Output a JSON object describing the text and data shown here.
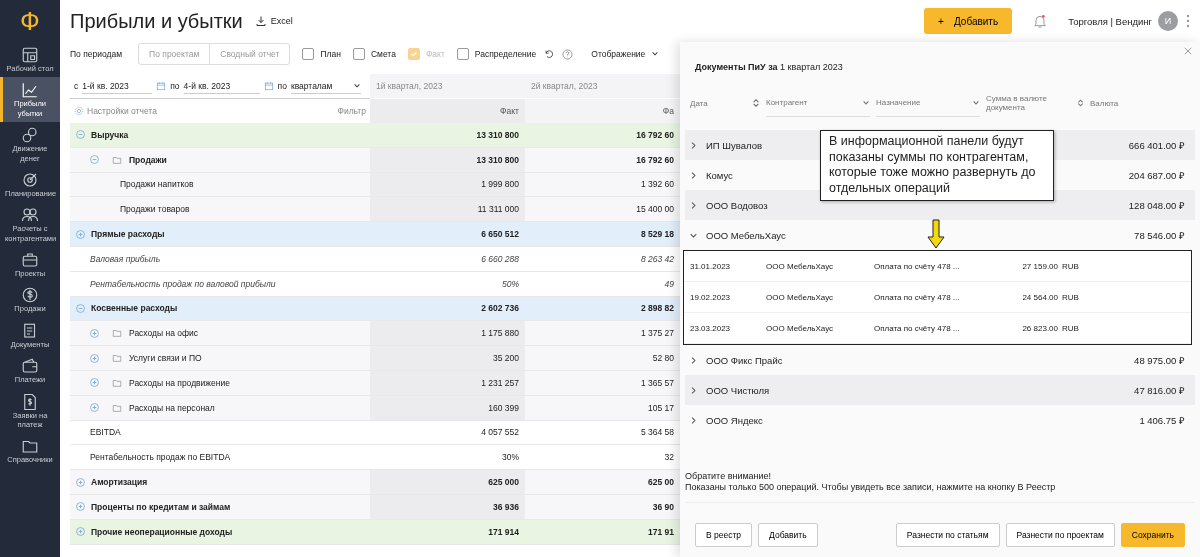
{
  "logo": "Ф",
  "sidebar": {
    "items": [
      {
        "label": "Рабочий стол",
        "selected": false
      },
      {
        "label": "Прибыли убытки",
        "selected": true
      },
      {
        "label": "Движение денег",
        "selected": false
      },
      {
        "label": "Планирование",
        "selected": false
      },
      {
        "label": "Расчеты с контрагентами",
        "selected": false
      },
      {
        "label": "Проекты",
        "selected": false
      },
      {
        "label": "Продажи",
        "selected": false
      },
      {
        "label": "Документы",
        "selected": false
      },
      {
        "label": "Платежи",
        "selected": false
      },
      {
        "label": "Заявки на платеж",
        "selected": false
      },
      {
        "label": "Справочники",
        "selected": false
      }
    ]
  },
  "page_title": "Прибыли и убытки",
  "export_label": "Excel",
  "add_button": "Добавить",
  "add_icon": "+",
  "account": {
    "name": "Торговля | Вендинг",
    "avatar": "И"
  },
  "view_tabs": [
    {
      "label": "По периодам",
      "selected": true
    },
    {
      "label": "По проектам",
      "selected": false
    },
    {
      "label": "Сводный отчет",
      "selected": false
    }
  ],
  "checkboxes": [
    {
      "label": "План",
      "checked": false,
      "disabled": false
    },
    {
      "label": "Смета",
      "checked": false,
      "disabled": false
    },
    {
      "label": "Факт",
      "checked": true,
      "disabled": true
    },
    {
      "label": "Распределение",
      "checked": false,
      "disabled": false
    }
  ],
  "display_menu": "Отображение",
  "period": {
    "from_label": "с",
    "from": "1-й кв. 2023",
    "to_label": "по",
    "to": "4-й кв. 2023",
    "by_label": "по",
    "by": "кварталам"
  },
  "settings_label": "Настройки отчета",
  "filter_label": "Фильтр",
  "table": {
    "columns": [
      {
        "period": "1й квартал, 2023",
        "measure": "Факт"
      },
      {
        "period": "2й квартал, 2023",
        "measure": "Фа"
      }
    ],
    "rows": [
      {
        "kind": "group",
        "label": "Выручка",
        "expanded": true,
        "color": "#e9f5e2",
        "values": [
          "13 310 800",
          "16 792 60"
        ]
      },
      {
        "kind": "folder",
        "label": "Продажи",
        "expanded": true,
        "values": [
          "13 310 800",
          "16 792 60"
        ]
      },
      {
        "kind": "leaf",
        "label": "Продажи напитков",
        "values": [
          "1 999 800",
          "1 392 60"
        ]
      },
      {
        "kind": "leaf",
        "label": "Продажи товаров",
        "values": [
          "11 311 000",
          "15 400 00"
        ]
      },
      {
        "kind": "group",
        "label": "Прямые расходы",
        "expanded": false,
        "color": "#e3eefb",
        "values": [
          "6 650 512",
          "8 529 18"
        ]
      },
      {
        "kind": "italic",
        "label": "Валовая прибыль",
        "values": [
          "6 660 288",
          "8 263 42"
        ]
      },
      {
        "kind": "italic",
        "label": "Рентабельность продаж по валовой прибыли",
        "values": [
          "50%",
          "49"
        ]
      },
      {
        "kind": "group",
        "label": "Косвенные расходы",
        "expanded": true,
        "color": "#e3eefb",
        "values": [
          "2 602 736",
          "2 898 82"
        ]
      },
      {
        "kind": "folder",
        "label": "Расходы на офис",
        "expanded": false,
        "values": [
          "1 175 880",
          "1 375 27"
        ]
      },
      {
        "kind": "folder",
        "label": "Услуги связи и ПО",
        "expanded": false,
        "values": [
          "35 200",
          "52 80"
        ]
      },
      {
        "kind": "folder",
        "label": "Расходы на продвижение",
        "expanded": false,
        "values": [
          "1 231 257",
          "1 365 57"
        ]
      },
      {
        "kind": "folder",
        "label": "Расходы на персонал",
        "expanded": false,
        "values": [
          "160 399",
          "105 17"
        ]
      },
      {
        "kind": "plain",
        "label": "EBITDA",
        "values": [
          "4 057 552",
          "5 364 58"
        ]
      },
      {
        "kind": "plain",
        "label": "Рентабельность продаж по EBITDA",
        "values": [
          "30%",
          "32"
        ]
      },
      {
        "kind": "group",
        "label": "Амортизация",
        "expanded": false,
        "values": [
          "625 000",
          "625 00"
        ]
      },
      {
        "kind": "group",
        "label": "Проценты по кредитам и займам",
        "expanded": false,
        "values": [
          "36 936",
          "36 90"
        ]
      },
      {
        "kind": "group",
        "label": "Прочие неоперационные доходы",
        "expanded": false,
        "color": "#e9f5e2",
        "values": [
          "171 914",
          "171 91"
        ]
      }
    ]
  },
  "panel": {
    "title": "**Документы ПиУ за** 1 квартал 2023",
    "columns": [
      {
        "label": "Дата",
        "kind": "sort"
      },
      {
        "label": "Контрагент",
        "kind": "select"
      },
      {
        "label": "Назначение",
        "kind": "select"
      },
      {
        "label": "Сумма в валюте документа",
        "kind": "sort"
      },
      {
        "label": "Валюта",
        "kind": "plain"
      }
    ],
    "counterparties": [
      {
        "name": "ИП Шувалов",
        "amount": "666 401.00 ₽",
        "expanded": false
      },
      {
        "name": "Комус",
        "amount": "204 687.00 ₽",
        "expanded": false
      },
      {
        "name": "ООО Водовоз",
        "amount": "128 048.00 ₽",
        "expanded": false
      },
      {
        "name": "ООО МебельХаус",
        "amount": "78 546.00 ₽",
        "expanded": true,
        "operations": [
          {
            "date": "31.01.2023",
            "counterparty": "ООО МебельХаус",
            "purpose": "Оплата по счёту 478 ...",
            "amount": "27 159.00",
            "currency": "RUB"
          },
          {
            "date": "19.02.2023",
            "counterparty": "ООО МебельХаус",
            "purpose": "Оплата по счёту 478 ...",
            "amount": "24 564.00",
            "currency": "RUB"
          },
          {
            "date": "23.03.2023",
            "counterparty": "ООО МебельХаус",
            "purpose": "Оплата по счёту 478 ...",
            "amount": "26 823.00",
            "currency": "RUB"
          }
        ]
      },
      {
        "name": "ООО Фикс Прайс",
        "amount": "48 975.00 ₽",
        "expanded": false
      },
      {
        "name": "ООО Чистюля",
        "amount": "47 816.00 ₽",
        "expanded": false
      },
      {
        "name": "ООО Яндекс",
        "amount": "1 406.75 ₽",
        "expanded": false
      }
    ],
    "notice_title": "Обратите внимание!",
    "notice_text": "Показаны только 500 операций. Чтобы увидеть все записи, нажмите на кнопку В Реестр",
    "left_buttons": [
      {
        "label": "В реестр",
        "kind": "secondary"
      },
      {
        "label": "Добавить",
        "kind": "secondary"
      }
    ],
    "right_buttons": [
      {
        "label": "Разнести по статьям",
        "kind": "secondary"
      },
      {
        "label": "Разнести по проектам",
        "kind": "secondary"
      },
      {
        "label": "Сохранить",
        "kind": "primary"
      }
    ]
  },
  "callout": "В информационной панели будут показаны суммы по контрагентам, которые тоже можно развернуть до отдельных операций"
}
